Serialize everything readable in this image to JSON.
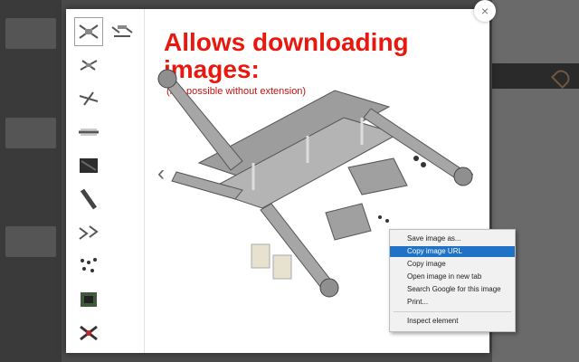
{
  "headline": {
    "line1": "Allows downloading",
    "line2": "images:"
  },
  "subline": "(not possible without extension)",
  "close_label": "×",
  "nav": {
    "prev": "‹",
    "next": "›"
  },
  "context_menu": {
    "items": [
      {
        "label": "Save image as...",
        "highlighted": false
      },
      {
        "label": "Copy image URL",
        "highlighted": true
      },
      {
        "label": "Copy image",
        "highlighted": false
      },
      {
        "label": "Open image in new tab",
        "highlighted": false
      },
      {
        "label": "Search Google for this image",
        "highlighted": false
      },
      {
        "label": "Print...",
        "highlighted": false
      },
      {
        "label": "Inspect element",
        "highlighted": false
      }
    ]
  },
  "thumbnails": [
    {
      "icon": "drone-frame-icon",
      "selected": true
    },
    {
      "icon": "drone-parts-icon",
      "selected": false
    },
    {
      "icon": "drone-frame-side-icon",
      "selected": false
    },
    {
      "icon": "drone-frame-angle-icon",
      "selected": false
    },
    {
      "icon": "drone-plate-icon",
      "selected": false
    },
    {
      "icon": "drone-carbon-plate-icon",
      "selected": false
    },
    {
      "icon": "drone-arm-icon",
      "selected": false
    },
    {
      "icon": "drone-brackets-icon",
      "selected": false
    },
    {
      "icon": "screws-icon",
      "selected": false
    },
    {
      "icon": "pcb-board-icon",
      "selected": false
    },
    {
      "icon": "drone-assembled-icon",
      "selected": false
    }
  ],
  "colors": {
    "headline": "#e8180f",
    "highlight": "#1f72c6"
  }
}
